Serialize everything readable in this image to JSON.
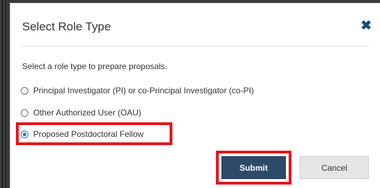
{
  "dialog": {
    "title": "Select Role Type",
    "close_icon": "close-icon",
    "instructions": "Select a role type to prepare proposals.",
    "options": [
      {
        "label": "Principal Investigator (PI) or co-Principal Investigator (co-PI)",
        "selected": false
      },
      {
        "label": "Other Authorized User (OAU)",
        "selected": false
      },
      {
        "label": "Proposed Postdoctoral Fellow",
        "selected": true
      }
    ],
    "submit_label": "Submit",
    "cancel_label": "Cancel"
  },
  "colors": {
    "close_icon": "#1a4f7a",
    "submit_bg": "#2d4a6b",
    "cancel_bg": "#e6e6e6",
    "highlight": "#e8141c",
    "radio_selected": "#1a73e8"
  }
}
